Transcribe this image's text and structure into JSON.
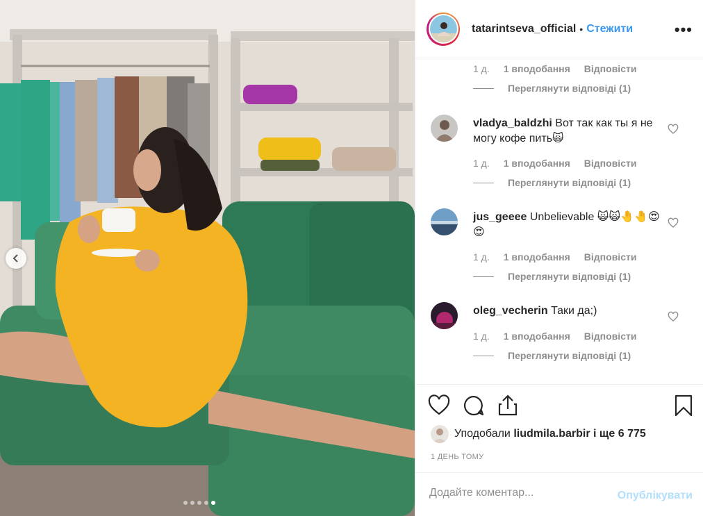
{
  "post": {
    "header": {
      "username": "tatarintseva_official",
      "separator": "•",
      "follow_label": "Стежити",
      "more_label": "•••"
    },
    "photo": {
      "carousel_count": 5,
      "carousel_active_index": 4
    },
    "comments": [
      {
        "username": "",
        "text": "",
        "age": "1 д.",
        "likes": "1 вподобання",
        "reply_label": "Відповісти",
        "view_replies": "Переглянути відповіді (1)"
      },
      {
        "username": "vladya_baldzhi",
        "text": "Вот так как ты я не могу кофе пить🙀",
        "age": "1 д.",
        "likes": "1 вподобання",
        "reply_label": "Відповісти",
        "view_replies": "Переглянути відповіді (1)"
      },
      {
        "username": "jus_geeee",
        "text": "Unbelievable 🙀🙀🤚🤚😍😍",
        "age": "1 д.",
        "likes": "1 вподобання",
        "reply_label": "Відповісти",
        "view_replies": "Переглянути відповіді (1)"
      },
      {
        "username": "oleg_vecherin",
        "text": "Таки да;)",
        "age": "1 д.",
        "likes": "1 вподобання",
        "reply_label": "Відповісти",
        "view_replies": "Переглянути відповіді (1)"
      }
    ],
    "liked_by": {
      "prefix": "Уподобали",
      "user": "liudmila.barbir",
      "suffix": "і ще 6 775"
    },
    "timestamp": "1 ДЕНЬ ТОМУ",
    "add_comment": {
      "placeholder": "Додайте коментар...",
      "publish_label": "Опублікувати"
    },
    "colors": {
      "link_blue": "#3897f0",
      "publish_disabled": "#b2dffc",
      "secondary_text": "#8e8e8e",
      "border": "#efefef",
      "sweater_yellow": "#f3b323",
      "sofa_green": "#3f8a63"
    },
    "icons": [
      "heart-icon",
      "comment-icon",
      "share-icon",
      "bookmark-icon",
      "chevron-left-icon",
      "more-icon"
    ]
  }
}
